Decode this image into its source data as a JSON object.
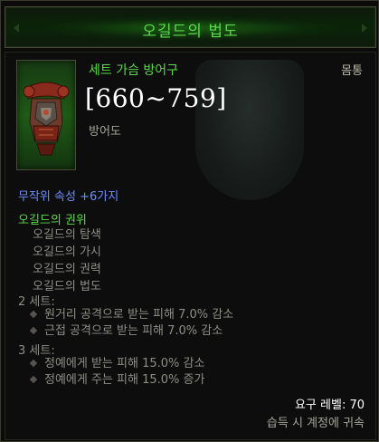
{
  "item": {
    "name": "오길드의 법도",
    "type": "세트 가슴 방어구",
    "slot": "몸통",
    "armor_range": "[660~759]",
    "armor_label": "방어도",
    "icon": "chest-armor-icon",
    "random_properties": "무작위 속성 +6가지"
  },
  "set": {
    "name": "오길드의 권위",
    "items": [
      "오길드의 탐색",
      "오길드의 가시",
      "오길드의 권력",
      "오길드의 법도"
    ],
    "bonuses": [
      {
        "tier": "2 세트:",
        "effects": [
          "원거리 공격으로 받는 피해 7.0% 감소",
          "근접 공격으로 받는 피해 7.0% 감소"
        ]
      },
      {
        "tier": "3 세트:",
        "effects": [
          "정예에게 받는 피해 15.0% 감소",
          "정예에게 주는 피해 15.0% 증가"
        ]
      }
    ]
  },
  "footer": {
    "required_level": "요구 레벨: 70",
    "bind": "습득 시 계정에 귀속"
  },
  "colors": {
    "set_green": "#5cd94c",
    "magic_blue": "#6e8cff",
    "muted_gray": "#8e8e86",
    "white": "#ffffff"
  }
}
